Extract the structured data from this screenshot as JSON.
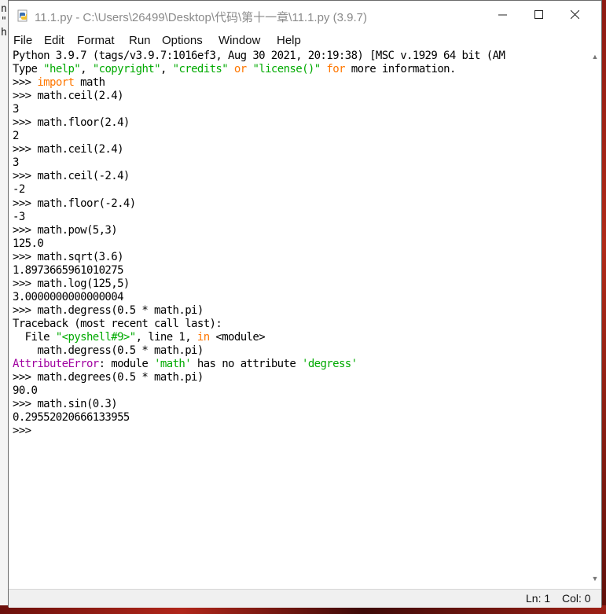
{
  "desktop": {
    "left_chars": [
      "n",
      "\"",
      "h"
    ]
  },
  "window": {
    "title": "11.1.py - C:\\Users\\26499\\Desktop\\代码\\第十一章\\11.1.py (3.9.7)",
    "controls": {
      "minimize": "—",
      "maximize": "☐",
      "close": "✕"
    }
  },
  "menu": {
    "items": [
      "File",
      "Edit",
      "Format",
      "Run",
      "Options",
      "Window",
      "Help"
    ]
  },
  "shell": {
    "lines": [
      [
        {
          "t": "Python 3.9.7 (tags/v3.9.7:1016ef3, Aug 30 2021, 20:19:38) [MSC v.1929 64 bit (AM"
        }
      ],
      [
        {
          "t": "Type "
        },
        {
          "t": "\"help\"",
          "c": "str"
        },
        {
          "t": ", "
        },
        {
          "t": "\"copyright\"",
          "c": "str"
        },
        {
          "t": ", "
        },
        {
          "t": "\"credits\"",
          "c": "str"
        },
        {
          "t": " "
        },
        {
          "t": "or",
          "c": "kw"
        },
        {
          "t": " "
        },
        {
          "t": "\"license()\"",
          "c": "str"
        },
        {
          "t": " "
        },
        {
          "t": "for",
          "c": "kw"
        },
        {
          "t": " more information."
        }
      ],
      [
        {
          "t": ">>> "
        },
        {
          "t": "import",
          "c": "kw"
        },
        {
          "t": " math"
        }
      ],
      [
        {
          "t": ">>> math.ceil(2.4)"
        }
      ],
      [
        {
          "t": "3"
        }
      ],
      [
        {
          "t": ">>> math.floor(2.4)"
        }
      ],
      [
        {
          "t": "2"
        }
      ],
      [
        {
          "t": ">>> math.ceil(2.4)"
        }
      ],
      [
        {
          "t": "3"
        }
      ],
      [
        {
          "t": ">>> math.ceil(-2.4)"
        }
      ],
      [
        {
          "t": "-2"
        }
      ],
      [
        {
          "t": ">>> math.floor(-2.4)"
        }
      ],
      [
        {
          "t": "-3"
        }
      ],
      [
        {
          "t": ">>> math.pow(5,3)"
        }
      ],
      [
        {
          "t": "125.0"
        }
      ],
      [
        {
          "t": ">>> math.sqrt(3.6)"
        }
      ],
      [
        {
          "t": "1.8973665961010275"
        }
      ],
      [
        {
          "t": ">>> math.log(125,5)"
        }
      ],
      [
        {
          "t": "3.0000000000000004"
        }
      ],
      [
        {
          "t": ">>> math.degress(0.5 * math.pi)"
        }
      ],
      [
        {
          "t": "Traceback (most recent call last):"
        }
      ],
      [
        {
          "t": "  File "
        },
        {
          "t": "\"<pyshell#9>\"",
          "c": "str"
        },
        {
          "t": ", line 1, "
        },
        {
          "t": "in",
          "c": "kw"
        },
        {
          "t": " <module>"
        }
      ],
      [
        {
          "t": "    math.degress(0.5 * math.pi)"
        }
      ],
      [
        {
          "t": "AttributeError",
          "c": "err"
        },
        {
          "t": ": module "
        },
        {
          "t": "'math'",
          "c": "str"
        },
        {
          "t": " has no attribute "
        },
        {
          "t": "'degress'",
          "c": "str"
        }
      ],
      [
        {
          "t": ">>> math.degrees(0.5 * math.pi)"
        }
      ],
      [
        {
          "t": "90.0"
        }
      ],
      [
        {
          "t": ">>> math.sin(0.3)"
        }
      ],
      [
        {
          "t": "0.29552020666133955"
        }
      ],
      [
        {
          "t": ">>> "
        }
      ]
    ]
  },
  "colors": {
    "keyword": "#ff7700",
    "string": "#00aa00",
    "error": "#a000a0"
  },
  "scroll": {
    "up_icon": "▲",
    "down_icon": "▼"
  },
  "status": {
    "ln": "Ln: 1",
    "col": "Col: 0"
  }
}
